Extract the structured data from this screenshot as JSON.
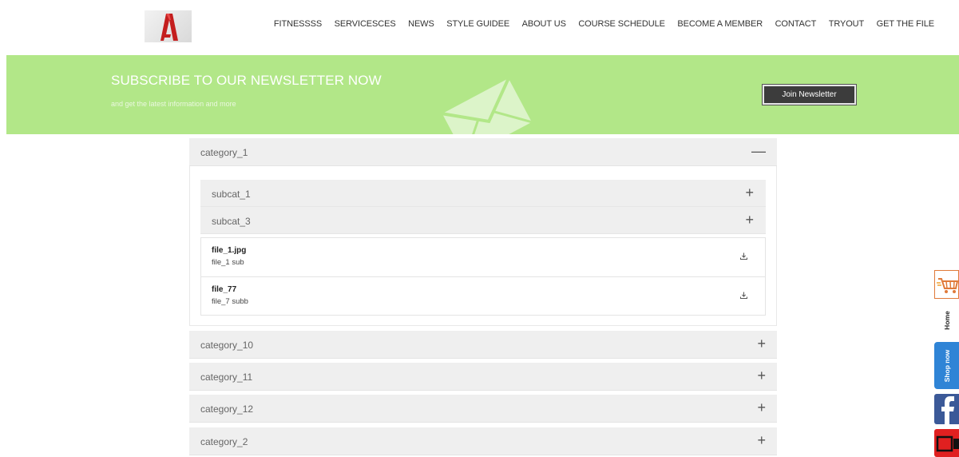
{
  "header": {
    "logo_icon": "autocad-logo-icon",
    "nav": [
      "FITNESSSS",
      "SERVICESCES",
      "NEWS",
      "STYLE GUIDEE",
      "ABOUT US",
      "COURSE SCHEDULE",
      "BECOME A MEMBER",
      "CONTACT",
      "TRYOUT",
      "GET THE FILE"
    ]
  },
  "newsletter": {
    "title": "SUBSCRIBE TO OUR NEWSLETTER NOW",
    "subtitle": "and get the latest information and more",
    "button": "Join Newsletter",
    "bg_color": "#b2e788"
  },
  "accordion": {
    "categories": [
      {
        "label": "category_1",
        "sign": "—",
        "expanded": true
      },
      {
        "label": "category_10",
        "sign": "+"
      },
      {
        "label": "category_11",
        "sign": "+"
      },
      {
        "label": "category_12",
        "sign": "+"
      },
      {
        "label": "category_2",
        "sign": "+"
      }
    ],
    "subcategories": [
      {
        "label": "subcat_1",
        "sign": "+"
      },
      {
        "label": "subcat_3",
        "sign": "+"
      }
    ],
    "files": [
      {
        "name": "file_1.jpg",
        "sub": "file_1 sub"
      },
      {
        "name": "file_77",
        "sub": "file_7 subb"
      }
    ]
  },
  "side": {
    "home": "Home",
    "shop": "Shop now",
    "cart_icon": "shopping-cart-icon",
    "facebook_icon": "facebook-icon",
    "youtube_icon": "youtube-icon"
  }
}
